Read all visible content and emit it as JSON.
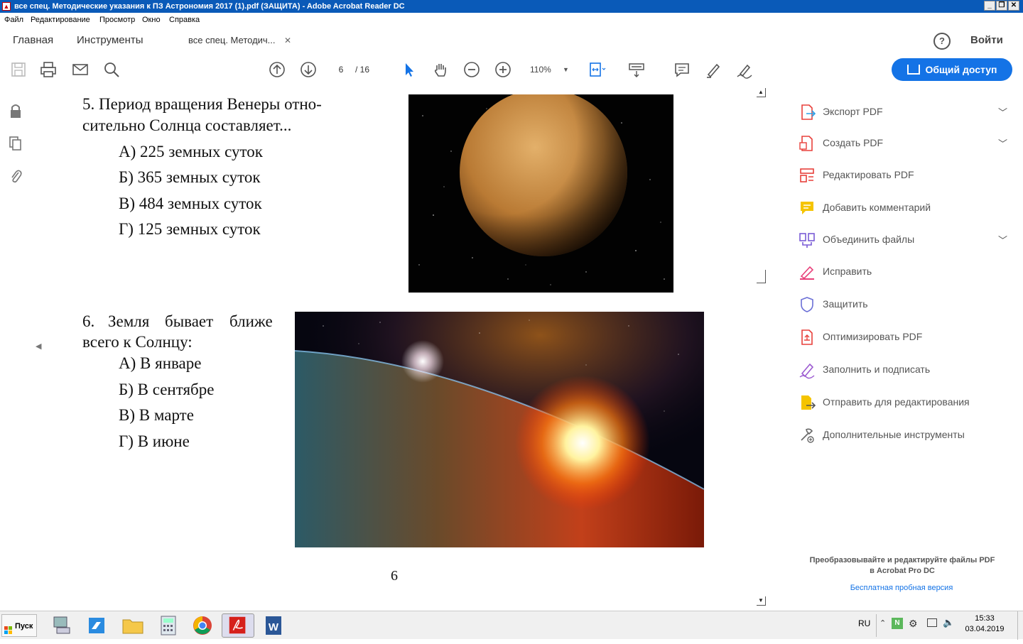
{
  "window": {
    "title": "все спец. Методические указания к ПЗ Астрономия 2017 (1).pdf (ЗАЩИТА) - Adobe Acrobat Reader DC",
    "controls": [
      "_",
      "❐",
      "✕"
    ]
  },
  "menu": [
    "Файл",
    "Редактирование",
    "Просмотр",
    "Окно",
    "Справка"
  ],
  "tabs": {
    "home": "Главная",
    "tools": "Инструменты",
    "doc": "все спец. Методич...",
    "close": "✕",
    "help": "?",
    "signin": "Войти"
  },
  "toolbar": {
    "page_current": "6",
    "page_total": "/ 16",
    "zoom": "110%",
    "share_label": "Общий доступ"
  },
  "document": {
    "q5": {
      "line1": "5. Период вращения Венеры отно-",
      "line2": "сительно Солнца составляет...",
      "options": [
        "А) 225 земных суток",
        "Б) 365 земных суток",
        "В) 484 земных суток",
        "Г) 125 земных суток"
      ]
    },
    "q6": {
      "line1_words": [
        "6.",
        "Земля",
        "бывает",
        "ближе"
      ],
      "line2": "всего к Солнцу:",
      "options": [
        "А) В январе",
        "Б) В сентябре",
        "В) В марте",
        "Г) В июне"
      ]
    },
    "page_number": "6"
  },
  "right_panel": {
    "items": [
      {
        "label": "Экспорт PDF",
        "icon": "export-pdf-icon",
        "color": "#e8403b",
        "chevron": true
      },
      {
        "label": "Создать PDF",
        "icon": "create-pdf-icon",
        "color": "#e8403b",
        "chevron": true
      },
      {
        "label": "Редактировать PDF",
        "icon": "edit-pdf-icon",
        "color": "#e8403b",
        "chevron": false
      },
      {
        "label": "Добавить комментарий",
        "icon": "comment-icon",
        "color": "#f5c400",
        "chevron": false
      },
      {
        "label": "Объединить файлы",
        "icon": "combine-files-icon",
        "color": "#7a5bd6",
        "chevron": true
      },
      {
        "label": "Исправить",
        "icon": "redact-icon",
        "color": "#e8407a",
        "chevron": false
      },
      {
        "label": "Защитить",
        "icon": "protect-icon",
        "color": "#6b6fd6",
        "chevron": false
      },
      {
        "label": "Оптимизировать PDF",
        "icon": "optimize-pdf-icon",
        "color": "#e8403b",
        "chevron": false
      },
      {
        "label": "Заполнить и подписать",
        "icon": "fill-sign-icon",
        "color": "#9b59d0",
        "chevron": false
      },
      {
        "label": "Отправить для редактирования",
        "icon": "send-review-icon",
        "color": "#f5c400",
        "chevron": false
      },
      {
        "label": "Дополнительные инструменты",
        "icon": "more-tools-icon",
        "color": "#666666",
        "chevron": false
      }
    ],
    "promo_line1": "Преобразовывайте и редактируйте файлы PDF",
    "promo_line2": "в Acrobat Pro DC",
    "trial_link": "Бесплатная пробная версия"
  },
  "taskbar": {
    "start": "Пуск",
    "lang": "RU",
    "time": "15:33",
    "date": "03.04.2019"
  },
  "colors": {
    "titlebar": "#0a5ab8",
    "accent": "#1473e6",
    "link": "#1473e6"
  }
}
